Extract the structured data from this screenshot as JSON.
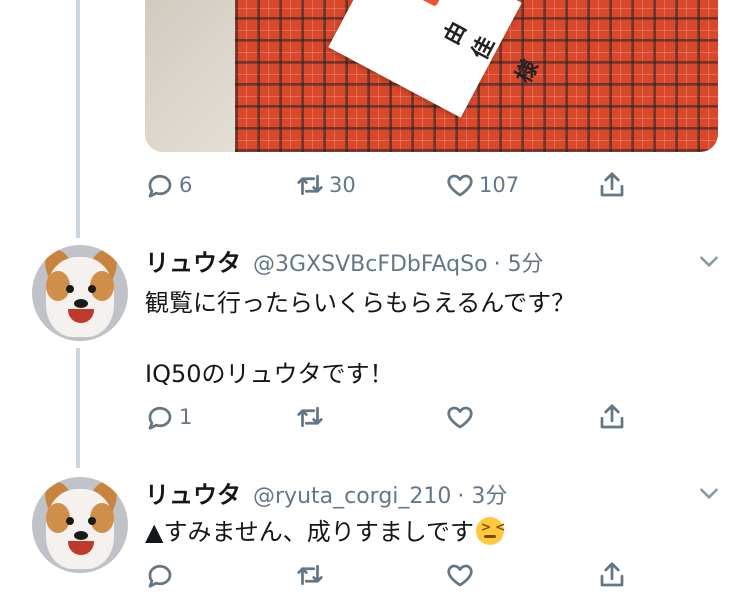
{
  "media": {
    "paper_text": "由佳 様"
  },
  "tweet0": {
    "reply_count": "6",
    "retweet_count": "30",
    "like_count": "107"
  },
  "tweet1": {
    "name": "リュウタ",
    "handle": "@3GXSVBcFDbFAqSo",
    "time": "· 5分",
    "line1": "観覧に行ったらいくらもらえるんです？",
    "line2": "IQ50のリュウタです！",
    "reply_count": "1",
    "retweet_count": "",
    "like_count": ""
  },
  "tweet2": {
    "name": "リュウタ",
    "handle": "@ryuta_corgi_210",
    "time": "· 3分",
    "text": "▲すみません、成りすましです",
    "emoji": "confounded-face-emoji",
    "reply_count": "",
    "retweet_count": "",
    "like_count": ""
  },
  "icons": {
    "reply": "reply-icon",
    "retweet": "retweet-icon",
    "like": "heart-icon",
    "share": "share-icon",
    "more": "chevron-down-icon"
  },
  "colors": {
    "text": "#14171a",
    "secondary": "#657786",
    "thread_line": "#ccd6dd"
  }
}
